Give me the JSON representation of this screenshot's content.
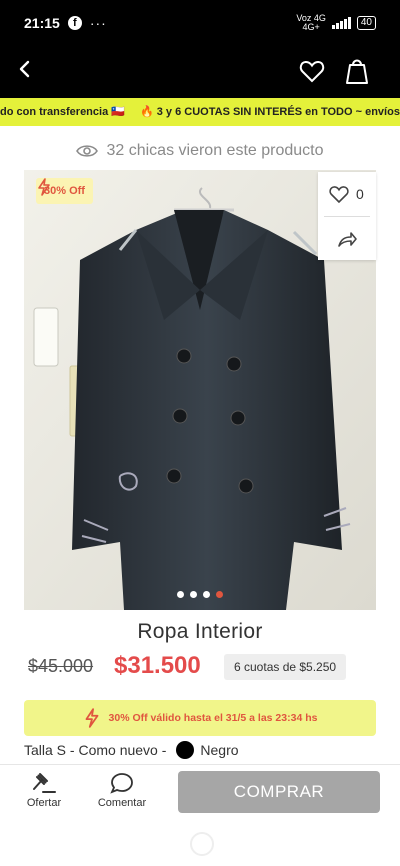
{
  "status_bar": {
    "time": "21:15",
    "more": "···",
    "network_top": "Voz 4G",
    "network_bottom": "4G+",
    "battery": "40"
  },
  "ticker": {
    "item1": "do con transferencia 🇨🇱",
    "item2": "🔥 3 y 6 CUOTAS SIN INTERÉS en TODO ~ envíos GRATIS"
  },
  "viewers": {
    "text": "32 chicas vieron este producto"
  },
  "product": {
    "discount_badge": "30% Off",
    "likes": "0",
    "title": "Ropa Interior",
    "old_price": "$45.000",
    "price": "$31.500",
    "installments": "6 cuotas de $5.250",
    "promo": "30% Off válido hasta el 31/5 a las 23:34 hs",
    "size_condition": "Talla S - Como nuevo -",
    "color_name": "Negro",
    "carousel": {
      "count": 4,
      "active": 3
    }
  },
  "bottom_bar": {
    "offer_label": "Ofertar",
    "comment_label": "Comentar",
    "buy_label": "COMPRAR"
  },
  "colors": {
    "accent_yellow": "#e4f13a",
    "price_red": "#e44b4b",
    "badge_red": "#e0563f",
    "buy_disabled": "#a6a6a6"
  }
}
